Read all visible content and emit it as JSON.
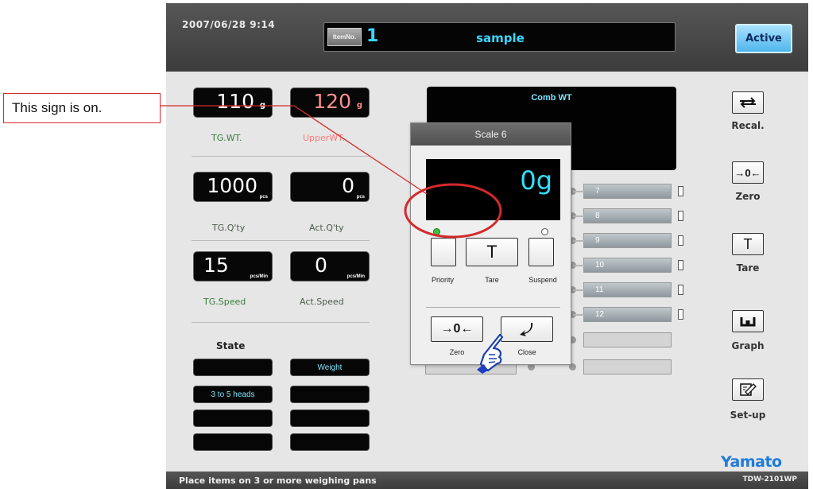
{
  "callout": {
    "text": "This sign is on."
  },
  "header": {
    "datetime": "2007/06/28  9:14",
    "item_no_label": "ItemNo.",
    "item_no": "1",
    "item_name": "sample",
    "active_label": "Active"
  },
  "metrics": {
    "tg_wt": {
      "value": "110",
      "unit": "g",
      "label": "TG.WT."
    },
    "upper_wt": {
      "value": "120",
      "unit": "g",
      "label": "UpperWT."
    },
    "tg_qty": {
      "value": "1000",
      "unit": "pcs",
      "label": "TG.Q'ty"
    },
    "act_qty": {
      "value": "0",
      "unit": "pcs",
      "label": "Act.Q'ty"
    },
    "tg_speed": {
      "value": "15",
      "unit": "pcs/Min",
      "label": "TG.Speed"
    },
    "act_speed": {
      "value": "0",
      "unit": "pcs/Min",
      "label": "Act.Speed"
    }
  },
  "state": {
    "label": "State",
    "boxes": [
      "",
      "Weight",
      "3 to 5 heads",
      "",
      "",
      "",
      "",
      ""
    ]
  },
  "comb": {
    "title": "Comb WT"
  },
  "pans": [
    "7",
    "8",
    "9",
    "10",
    "11",
    "12",
    "",
    ""
  ],
  "sidebar": {
    "recal": "Recal.",
    "zero": "Zero",
    "zero_symbol": "→0←",
    "tare": "Tare",
    "tare_symbol": "T",
    "graph": "Graph",
    "setup": "Set-up"
  },
  "brand": "Yamato",
  "status": {
    "message": "Place items on 3 or more weighing pans",
    "model": "TDW-2101WP"
  },
  "popup": {
    "title": "Scale 6",
    "value": "0g",
    "priority_label": "Priority",
    "tare_label": "Tare",
    "tare_symbol": "T",
    "suspend_label": "Suspend",
    "zero_label": "Zero",
    "zero_symbol": "→0←",
    "close_label": "Close",
    "priority_lamp": "on",
    "suspend_lamp": "off"
  },
  "colors": {
    "accent": "#2fe0ff",
    "callout_border": "#d42a2a",
    "brand": "#1f7bdb"
  }
}
